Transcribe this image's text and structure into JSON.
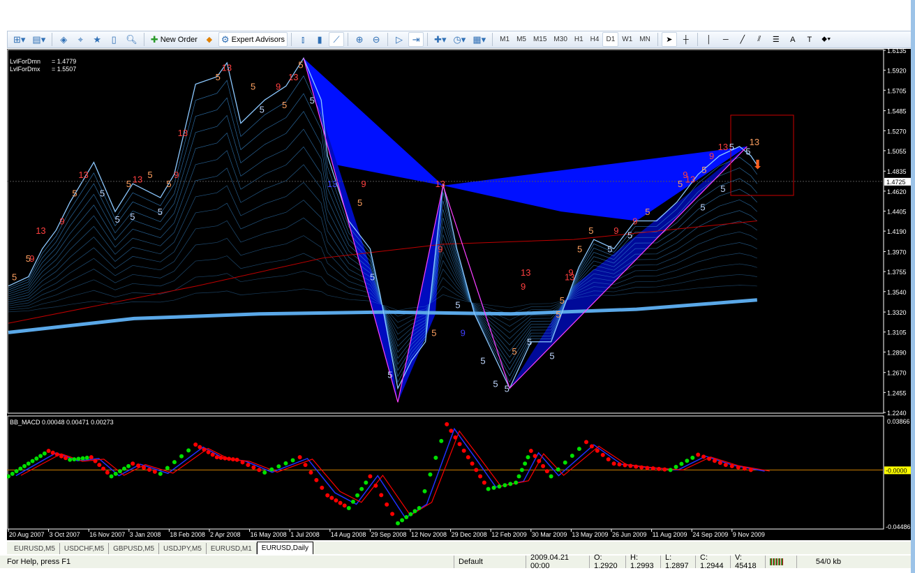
{
  "toolbar": {
    "new_order": "New Order",
    "expert_advisors": "Expert Advisors",
    "timeframes": [
      "M1",
      "M5",
      "M15",
      "M30",
      "H1",
      "H4",
      "D1",
      "W1",
      "MN"
    ],
    "active_timeframe": "D1"
  },
  "info": {
    "lvl_dmn_label": "LvlForDmn",
    "lvl_dmn_value": "= 1.4779",
    "lvl_dmx_label": "LvlForDmx",
    "lvl_dmx_value": "= 1.5507"
  },
  "indicator_label": "BB_MACD 0.00048 0.00471 0.00273",
  "tabs": [
    "EURUSD,M5",
    "USDCHF,M5",
    "GBPUSD,M5",
    "USDJPY,M5",
    "EURUSD,M1",
    "EURUSD,Daily"
  ],
  "active_tab": "EURUSD,Daily",
  "status": {
    "help": "For Help, press F1",
    "profile": "Default",
    "datetime": "2009.04.21 00:00",
    "open": "O: 1.2920",
    "high": "H: 1.2993",
    "low": "L: 1.2897",
    "close": "C: 1.2944",
    "volume": "V: 45418",
    "traffic": "54/0 kb"
  },
  "chart_data": {
    "type": "line",
    "symbol": "EURUSD",
    "period": "Daily",
    "price_ticks": [
      "1.6135",
      "1.5920",
      "1.5705",
      "1.5485",
      "1.5270",
      "1.5055",
      "1.4835",
      "1.4620",
      "1.4405",
      "1.4190",
      "1.3970",
      "1.3755",
      "1.3540",
      "1.3320",
      "1.3105",
      "1.2890",
      "1.2670",
      "1.2455",
      "1.2240"
    ],
    "price_range": [
      1.224,
      1.6135
    ],
    "current_price": "1.4725",
    "date_ticks": [
      "20 Aug 2007",
      "3 Oct 2007",
      "16 Nov 2007",
      "3 Jan 2008",
      "18 Feb 2008",
      "2 Apr 2008",
      "16 May 2008",
      "1 Jul 2008",
      "14 Aug 2008",
      "29 Sep 2008",
      "12 Nov 2008",
      "29 Dec 2008",
      "12 Feb 2009",
      "30 Mar 2009",
      "13 May 2009",
      "26 Jun 2009",
      "11 Aug 2009",
      "24 Sep 2009",
      "9 Nov 2009"
    ],
    "bars_per_date_tick": 32,
    "price": [
      [
        0,
        1.36
      ],
      [
        16,
        1.37
      ],
      [
        27,
        1.4
      ],
      [
        38,
        1.42
      ],
      [
        49,
        1.45
      ],
      [
        68,
        1.493
      ],
      [
        85,
        1.44
      ],
      [
        99,
        1.47
      ],
      [
        121,
        1.455
      ],
      [
        132,
        1.48
      ],
      [
        149,
        1.577
      ],
      [
        166,
        1.585
      ],
      [
        174,
        1.6
      ],
      [
        185,
        1.535
      ],
      [
        204,
        1.56
      ],
      [
        221,
        1.575
      ],
      [
        235,
        1.605
      ],
      [
        249,
        1.56
      ],
      [
        254,
        1.5
      ],
      [
        271,
        1.43
      ],
      [
        288,
        1.4
      ],
      [
        296,
        1.35
      ],
      [
        310,
        1.25
      ],
      [
        321,
        1.28
      ],
      [
        332,
        1.3
      ],
      [
        346,
        1.47
      ],
      [
        357,
        1.4
      ],
      [
        371,
        1.33
      ],
      [
        385,
        1.29
      ],
      [
        399,
        1.25
      ],
      [
        416,
        1.3
      ],
      [
        432,
        1.3
      ],
      [
        443,
        1.34
      ],
      [
        454,
        1.38
      ],
      [
        466,
        1.41
      ],
      [
        482,
        1.4
      ],
      [
        499,
        1.43
      ],
      [
        516,
        1.43
      ],
      [
        532,
        1.45
      ],
      [
        549,
        1.48
      ],
      [
        566,
        1.5
      ],
      [
        582,
        1.51
      ],
      [
        591,
        1.5
      ],
      [
        596,
        1.49
      ]
    ],
    "zigzag": [
      [
        235,
        1.605
      ],
      [
        310,
        1.235
      ],
      [
        346,
        1.468
      ],
      [
        399,
        1.25
      ],
      [
        588,
        1.51
      ]
    ],
    "ma_slow": [
      [
        0,
        1.31
      ],
      [
        100,
        1.325
      ],
      [
        200,
        1.33
      ],
      [
        300,
        1.332
      ],
      [
        400,
        1.33
      ],
      [
        500,
        1.335
      ],
      [
        596,
        1.345
      ]
    ],
    "ma_red": [
      [
        0,
        1.32
      ],
      [
        150,
        1.36
      ],
      [
        250,
        1.39
      ],
      [
        346,
        1.405
      ],
      [
        450,
        1.41
      ],
      [
        596,
        1.43
      ]
    ],
    "counts": [
      [
        5,
        1.37,
        "5",
        "#ffa060"
      ],
      [
        16,
        1.39,
        "5",
        "#ffa060"
      ],
      [
        19,
        1.39,
        "9",
        "#ff4040"
      ],
      [
        24,
        1.42,
        "13",
        "#ff4040"
      ],
      [
        43,
        1.43,
        "9",
        "#ff4040"
      ],
      [
        53,
        1.46,
        "5",
        "#ffa060"
      ],
      [
        58,
        1.48,
        "13",
        "#ff4040"
      ],
      [
        75,
        1.46,
        "5",
        "#c0d8ff"
      ],
      [
        87,
        1.432,
        "5",
        "#c0d8ff"
      ],
      [
        96,
        1.47,
        "5",
        "#ffa060"
      ],
      [
        101,
        1.475,
        "13",
        "#ff4040"
      ],
      [
        99,
        1.435,
        "5",
        "#c0d8ff"
      ],
      [
        113,
        1.48,
        "5",
        "#ffa060"
      ],
      [
        121,
        1.44,
        "5",
        "#c0d8ff"
      ],
      [
        128,
        1.47,
        "5",
        "#ffa060"
      ],
      [
        134,
        1.48,
        "9",
        "#ff4040"
      ],
      [
        137,
        1.525,
        "13",
        "#ff4040"
      ],
      [
        167,
        1.585,
        "5",
        "#ffa060"
      ],
      [
        172,
        1.595,
        "13",
        "#ff4040"
      ],
      [
        195,
        1.575,
        "5",
        "#ffa060"
      ],
      [
        202,
        1.55,
        "5",
        "#c0d8ff"
      ],
      [
        215,
        1.575,
        "9",
        "#ff4040"
      ],
      [
        220,
        1.555,
        "5",
        "#ffa060"
      ],
      [
        225,
        1.585,
        "13",
        "#ff4040"
      ],
      [
        233,
        1.598,
        "5",
        "#ffa060"
      ],
      [
        242,
        1.56,
        "5",
        "#c0d8ff"
      ],
      [
        256,
        1.47,
        "13",
        "#4040ff"
      ],
      [
        283,
        1.47,
        "9",
        "#ff4040"
      ],
      [
        280,
        1.45,
        "5",
        "#ffa060"
      ],
      [
        290,
        1.37,
        "5",
        "#c0d8ff"
      ],
      [
        304,
        1.265,
        "5",
        "#c0d8ff"
      ],
      [
        342,
        1.47,
        "13",
        "#ff4040"
      ],
      [
        344,
        1.4,
        "9",
        "#ff4040"
      ],
      [
        339,
        1.31,
        "5",
        "#ffa060"
      ],
      [
        358,
        1.34,
        "5",
        "#c0d8ff"
      ],
      [
        362,
        1.31,
        "9",
        "#4040ff"
      ],
      [
        378,
        1.28,
        "5",
        "#c0d8ff"
      ],
      [
        388,
        1.255,
        "5",
        "#c0d8ff"
      ],
      [
        397,
        1.25,
        "5",
        "#c0d8ff"
      ],
      [
        403,
        1.29,
        "5",
        "#ffa060"
      ],
      [
        410,
        1.36,
        "9",
        "#ff4040"
      ],
      [
        410,
        1.375,
        "13",
        "#ff4040"
      ],
      [
        415,
        1.3,
        "5",
        "#c0d8ff"
      ],
      [
        433,
        1.285,
        "5",
        "#c0d8ff"
      ],
      [
        438,
        1.33,
        "5",
        "#ffa060"
      ],
      [
        441,
        1.345,
        "5",
        "#ffa060"
      ],
      [
        445,
        1.37,
        "13",
        "#ff4040"
      ],
      [
        448,
        1.375,
        "9",
        "#ff4040"
      ],
      [
        455,
        1.4,
        "5",
        "#ffa060"
      ],
      [
        464,
        1.42,
        "5",
        "#ffa060"
      ],
      [
        479,
        1.4,
        "5",
        "#c0d8ff"
      ],
      [
        484,
        1.42,
        "9",
        "#ff4040"
      ],
      [
        495,
        1.415,
        "5",
        "#c0d8ff"
      ],
      [
        499,
        1.43,
        "9",
        "#ff4040"
      ],
      [
        509,
        1.44,
        "5",
        "#ffa060"
      ],
      [
        535,
        1.47,
        "5",
        "#ffa060"
      ],
      [
        539,
        1.48,
        "9",
        "#ff4040"
      ],
      [
        541,
        1.475,
        "13",
        "#ff4040"
      ],
      [
        553,
        1.445,
        "5",
        "#c0d8ff"
      ],
      [
        554,
        1.485,
        "5",
        "#ffa060"
      ],
      [
        560,
        1.5,
        "9",
        "#ff4040"
      ],
      [
        567,
        1.51,
        "13",
        "#ff4040"
      ],
      [
        569,
        1.465,
        "5",
        "#c0d8ff"
      ],
      [
        576,
        1.51,
        "5",
        "#c0d8ff"
      ],
      [
        589,
        1.505,
        "5",
        "#c0d8ff"
      ],
      [
        592,
        1.515,
        "13",
        "#ffa060"
      ]
    ],
    "macd": {
      "label": "BB_MACD",
      "ticks": [
        "0.03866",
        "-0.0000",
        "-0.04486"
      ],
      "range": [
        -0.04486,
        0.03866
      ],
      "values": [
        [
          0,
          -0.005
        ],
        [
          16,
          0.005
        ],
        [
          32,
          0.015
        ],
        [
          49,
          0.008
        ],
        [
          66,
          0.01
        ],
        [
          82,
          -0.005
        ],
        [
          99,
          0.005
        ],
        [
          121,
          -0.003
        ],
        [
          149,
          0.02
        ],
        [
          166,
          0.01
        ],
        [
          182,
          0.008
        ],
        [
          204,
          -0.002
        ],
        [
          232,
          0.01
        ],
        [
          254,
          -0.02
        ],
        [
          271,
          -0.03
        ],
        [
          288,
          -0.005
        ],
        [
          310,
          -0.042
        ],
        [
          327,
          -0.03
        ],
        [
          349,
          0.036
        ],
        [
          366,
          0.01
        ],
        [
          382,
          -0.015
        ],
        [
          404,
          -0.01
        ],
        [
          416,
          0.015
        ],
        [
          432,
          -0.005
        ],
        [
          460,
          0.022
        ],
        [
          482,
          0.005
        ],
        [
          504,
          0.002
        ],
        [
          527,
          0.0
        ],
        [
          549,
          0.012
        ],
        [
          571,
          0.004
        ],
        [
          596,
          -0.001
        ]
      ]
    }
  },
  "colors": {
    "bg": "#000000",
    "zigzag": "#ff40ff",
    "fill": "#0010ff",
    "fan": "#3a8fd8",
    "ma": "#5aa8e8",
    "red": "#c00000",
    "macd_up": "#00e000",
    "macd_dn": "#ff0000",
    "signal": "#2030ff",
    "zero": "#d08000"
  }
}
